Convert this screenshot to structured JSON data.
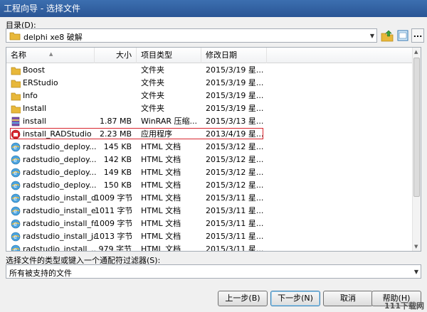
{
  "window": {
    "title": "工程向导 - 选择文件"
  },
  "directory": {
    "label": "目录(D):",
    "value": "delphi xe8 破解"
  },
  "toolbar": {
    "more_label": "..."
  },
  "columns": {
    "name": "名称",
    "size": "大小",
    "type": "项目类型",
    "date": "修改日期"
  },
  "files": [
    {
      "name": "Boost",
      "size": "",
      "type": "文件夹",
      "date": "2015/3/19 星...",
      "icon": "folder-icon"
    },
    {
      "name": "ERStudio",
      "size": "",
      "type": "文件夹",
      "date": "2015/3/19 星...",
      "icon": "folder-icon"
    },
    {
      "name": "Info",
      "size": "",
      "type": "文件夹",
      "date": "2015/3/19 星...",
      "icon": "folder-icon"
    },
    {
      "name": "Install",
      "size": "",
      "type": "文件夹",
      "date": "2015/3/19 星...",
      "icon": "folder-icon"
    },
    {
      "name": "install",
      "size": "1.87 MB",
      "type": "WinRAR 压缩...",
      "date": "2015/3/13 星...",
      "icon": "rar-archive-icon"
    },
    {
      "name": "install_RADStudio",
      "size": "2.23 MB",
      "type": "应用程序",
      "date": "2013/4/19 星...",
      "icon": "application-icon"
    },
    {
      "name": "radstudio_deploy...",
      "size": "145 KB",
      "type": "HTML 文档",
      "date": "2015/3/12 星...",
      "icon": "html-document-icon"
    },
    {
      "name": "radstudio_deploy...",
      "size": "142 KB",
      "type": "HTML 文档",
      "date": "2015/3/12 星...",
      "icon": "html-document-icon"
    },
    {
      "name": "radstudio_deploy...",
      "size": "149 KB",
      "type": "HTML 文档",
      "date": "2015/3/12 星...",
      "icon": "html-document-icon"
    },
    {
      "name": "radstudio_deploy...",
      "size": "150 KB",
      "type": "HTML 文档",
      "date": "2015/3/12 星...",
      "icon": "html-document-icon"
    },
    {
      "name": "radstudio_install_de",
      "size": "1009 字节",
      "type": "HTML 文档",
      "date": "2015/3/11 星...",
      "icon": "html-document-icon"
    },
    {
      "name": "radstudio_install_en",
      "size": "1011 字节",
      "type": "HTML 文档",
      "date": "2015/3/11 星...",
      "icon": "html-document-icon"
    },
    {
      "name": "radstudio_install_fr",
      "size": "1009 字节",
      "type": "HTML 文档",
      "date": "2015/3/11 星...",
      "icon": "html-document-icon"
    },
    {
      "name": "radstudio_install_ja",
      "size": "1013 字节",
      "type": "HTML 文档",
      "date": "2015/3/11 星...",
      "icon": "html-document-icon"
    },
    {
      "name": "radstudio_install_...",
      "size": "979 字节",
      "type": "HTML 文档",
      "date": "2015/3/11 星...",
      "icon": "html-document-icon"
    }
  ],
  "filter": {
    "label": "选择文件的类型或键入一个通配符过滤器(S):",
    "value": "所有被支持的文件"
  },
  "buttons": {
    "back": "上一步(B)",
    "next": "下一步(N)",
    "cancel": "取消",
    "help": "帮助(H)"
  },
  "watermark": "111下载网",
  "colors": {
    "highlight_border": "#d8262e",
    "titlebar": "#2a5595"
  }
}
